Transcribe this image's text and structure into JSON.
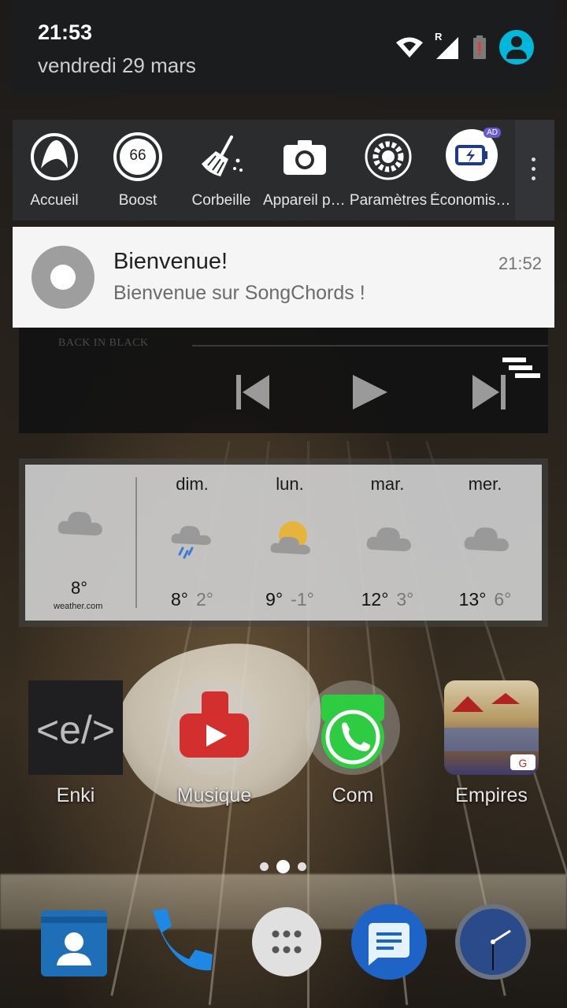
{
  "status": {
    "time": "21:53",
    "date": "vendredi 29 mars",
    "network_letter": "R"
  },
  "quick_apps": [
    {
      "label": "Accueil",
      "icon": "home-a-icon"
    },
    {
      "label": "Boost",
      "icon": "boost-gauge-icon",
      "value": "66"
    },
    {
      "label": "Corbeille",
      "icon": "broom-icon"
    },
    {
      "label": "Appareil photo",
      "icon": "camera-icon"
    },
    {
      "label": "Paramètres",
      "icon": "gear-icon"
    },
    {
      "label": "Économiseur",
      "icon": "battery-saver-icon",
      "badge": "AD"
    }
  ],
  "notification": {
    "title": "Bienvenue!",
    "body": "Bienvenue sur SongChords !",
    "time": "21:52"
  },
  "music": {
    "track": "BACK IN BLACK"
  },
  "weather": {
    "current_temp": "8°",
    "provider": "weather.com",
    "days": [
      {
        "name": "dim.",
        "high": "8°",
        "low": "2°",
        "icon": "rain-icon"
      },
      {
        "name": "lun.",
        "high": "9°",
        "low": "-1°",
        "icon": "partly-sunny-icon"
      },
      {
        "name": "mar.",
        "high": "12°",
        "low": "3°",
        "icon": "cloudy-icon"
      },
      {
        "name": "mer.",
        "high": "13°",
        "low": "6°",
        "icon": "cloudy-icon"
      }
    ]
  },
  "home_apps": [
    {
      "label": "Enki"
    },
    {
      "label": "Musique"
    },
    {
      "label": "Com"
    },
    {
      "label": "Empires"
    }
  ],
  "colors": {
    "accent": "#00b8d9",
    "youtube": "#e53935",
    "whatsapp": "#2ecc40",
    "messages": "#1e63c6"
  }
}
